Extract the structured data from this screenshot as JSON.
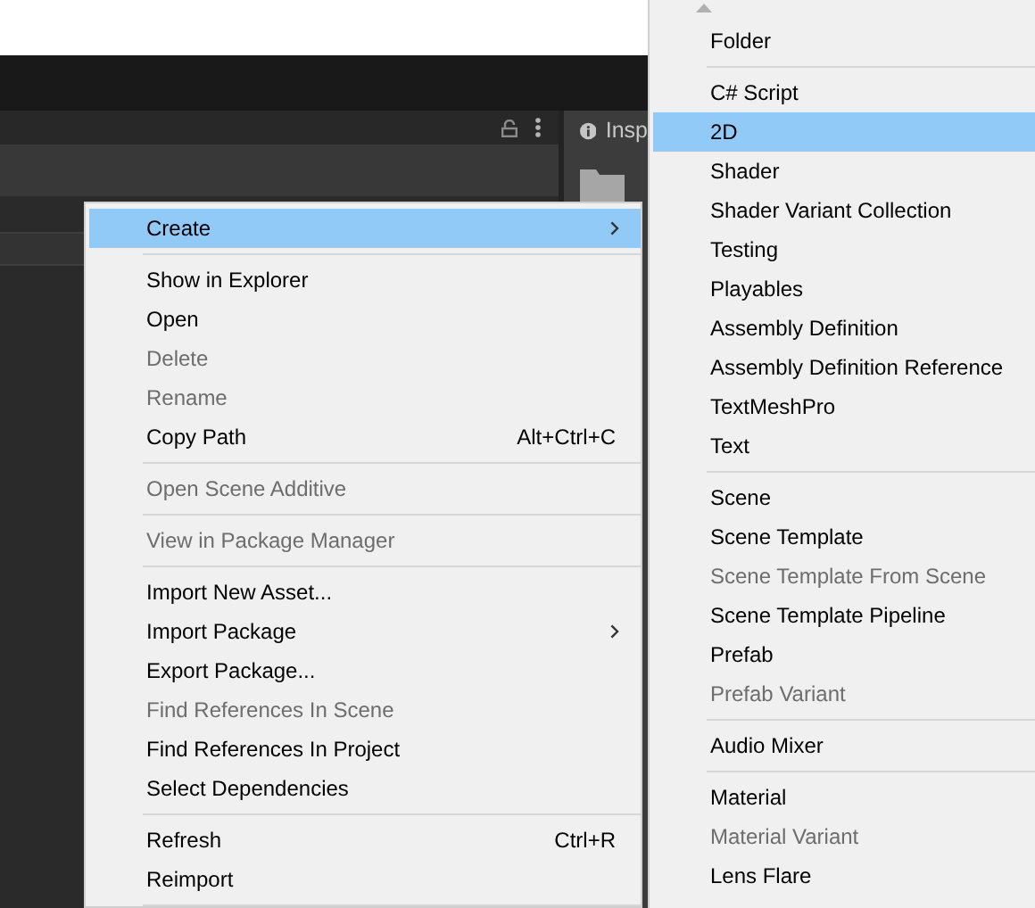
{
  "editor": {
    "inspector_tab": {
      "label": "Insp"
    }
  },
  "context_menu": {
    "items": [
      {
        "kind": "item",
        "label": "Create",
        "disabled": false,
        "submenu": true,
        "selected": true
      },
      {
        "kind": "separator"
      },
      {
        "kind": "item",
        "label": "Show in Explorer",
        "disabled": false,
        "submenu": false,
        "selected": false
      },
      {
        "kind": "item",
        "label": "Open",
        "disabled": false,
        "submenu": false,
        "selected": false
      },
      {
        "kind": "item",
        "label": "Delete",
        "disabled": true,
        "submenu": false,
        "selected": false
      },
      {
        "kind": "item",
        "label": "Rename",
        "disabled": true,
        "submenu": false,
        "selected": false
      },
      {
        "kind": "item",
        "label": "Copy Path",
        "shortcut": "Alt+Ctrl+C",
        "disabled": false,
        "submenu": false,
        "selected": false
      },
      {
        "kind": "separator"
      },
      {
        "kind": "item",
        "label": "Open Scene Additive",
        "disabled": true,
        "submenu": false,
        "selected": false
      },
      {
        "kind": "separator"
      },
      {
        "kind": "item",
        "label": "View in Package Manager",
        "disabled": true,
        "submenu": false,
        "selected": false
      },
      {
        "kind": "separator"
      },
      {
        "kind": "item",
        "label": "Import New Asset...",
        "disabled": false,
        "submenu": false,
        "selected": false
      },
      {
        "kind": "item",
        "label": "Import Package",
        "disabled": false,
        "submenu": true,
        "selected": false
      },
      {
        "kind": "item",
        "label": "Export Package...",
        "disabled": false,
        "submenu": false,
        "selected": false
      },
      {
        "kind": "item",
        "label": "Find References In Scene",
        "disabled": true,
        "submenu": false,
        "selected": false
      },
      {
        "kind": "item",
        "label": "Find References In Project",
        "disabled": false,
        "submenu": false,
        "selected": false
      },
      {
        "kind": "item",
        "label": "Select Dependencies",
        "disabled": false,
        "submenu": false,
        "selected": false
      },
      {
        "kind": "separator"
      },
      {
        "kind": "item",
        "label": "Refresh",
        "shortcut": "Ctrl+R",
        "disabled": false,
        "submenu": false,
        "selected": false
      },
      {
        "kind": "item",
        "label": "Reimport",
        "disabled": false,
        "submenu": false,
        "selected": false
      },
      {
        "kind": "separator"
      }
    ]
  },
  "create_submenu": {
    "items": [
      {
        "kind": "item",
        "label": "Folder",
        "disabled": false,
        "selected": false
      },
      {
        "kind": "separator"
      },
      {
        "kind": "item",
        "label": "C# Script",
        "disabled": false,
        "selected": false
      },
      {
        "kind": "item",
        "label": "2D",
        "disabled": false,
        "selected": true
      },
      {
        "kind": "item",
        "label": "Shader",
        "disabled": false,
        "selected": false
      },
      {
        "kind": "item",
        "label": "Shader Variant Collection",
        "disabled": false,
        "selected": false
      },
      {
        "kind": "item",
        "label": "Testing",
        "disabled": false,
        "selected": false
      },
      {
        "kind": "item",
        "label": "Playables",
        "disabled": false,
        "selected": false
      },
      {
        "kind": "item",
        "label": "Assembly Definition",
        "disabled": false,
        "selected": false
      },
      {
        "kind": "item",
        "label": "Assembly Definition Reference",
        "disabled": false,
        "selected": false
      },
      {
        "kind": "item",
        "label": "TextMeshPro",
        "disabled": false,
        "selected": false
      },
      {
        "kind": "item",
        "label": "Text",
        "disabled": false,
        "selected": false
      },
      {
        "kind": "separator"
      },
      {
        "kind": "item",
        "label": "Scene",
        "disabled": false,
        "selected": false
      },
      {
        "kind": "item",
        "label": "Scene Template",
        "disabled": false,
        "selected": false
      },
      {
        "kind": "item",
        "label": "Scene Template From Scene",
        "disabled": true,
        "selected": false
      },
      {
        "kind": "item",
        "label": "Scene Template Pipeline",
        "disabled": false,
        "selected": false
      },
      {
        "kind": "item",
        "label": "Prefab",
        "disabled": false,
        "selected": false
      },
      {
        "kind": "item",
        "label": "Prefab Variant",
        "disabled": true,
        "selected": false
      },
      {
        "kind": "separator"
      },
      {
        "kind": "item",
        "label": "Audio Mixer",
        "disabled": false,
        "selected": false
      },
      {
        "kind": "separator"
      },
      {
        "kind": "item",
        "label": "Material",
        "disabled": false,
        "selected": false
      },
      {
        "kind": "item",
        "label": "Material Variant",
        "disabled": true,
        "selected": false
      },
      {
        "kind": "item",
        "label": "Lens Flare",
        "disabled": false,
        "selected": false
      }
    ]
  }
}
